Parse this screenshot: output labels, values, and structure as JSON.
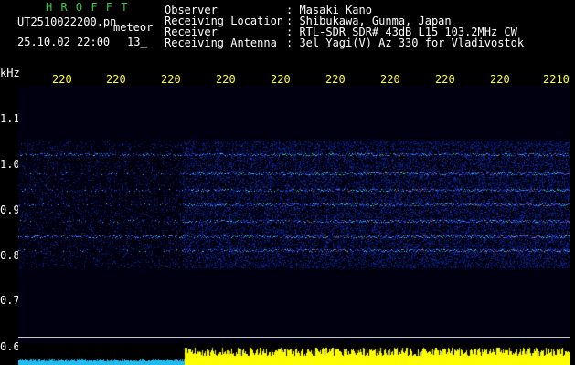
{
  "header": {
    "title": "H R O F F T",
    "filename": "UT2510022200.pn",
    "mode": "meteor",
    "datetime": "25.10.02 22:00",
    "counter": "13_",
    "fields": [
      {
        "label": "Observer",
        "value": ": Masaki Kano"
      },
      {
        "label": "Receiving Location",
        "value": ": Shibukawa, Gunma, Japan"
      },
      {
        "label": "Receiver",
        "value": ": RTL-SDR SDR# 43dB L15 103.2MHz CW"
      },
      {
        "label": "Receiving Antenna",
        "value": ": 3el Yagi(V) Az 330 for Vladivostok"
      }
    ]
  },
  "axis": {
    "unit": "kHz",
    "time_ticks": [
      "220",
      "220",
      "220",
      "220",
      "220",
      "220",
      "220",
      "220",
      "220",
      "2210"
    ],
    "freq_ticks": [
      "1.1",
      "1.0",
      "0.9",
      "0.8",
      "0.7",
      "0.6"
    ]
  },
  "colors": {
    "header_green": "#33cc33",
    "tick_yellow": "#ffff33",
    "level_cyan": "#22bbee",
    "level_yellow": "#ffff00"
  }
}
